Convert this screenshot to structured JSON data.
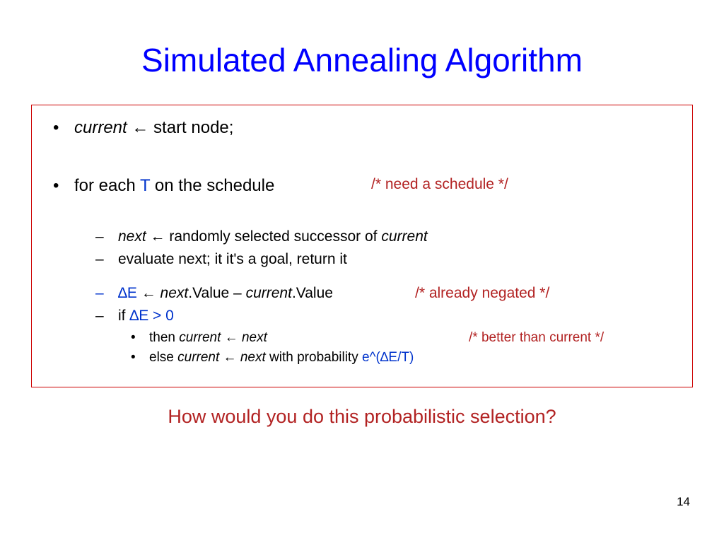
{
  "title": "Simulated Annealing Algorithm",
  "lines": {
    "l1a_pre": "current",
    "l1a_arrow": " ← ",
    "l1a_post": "start node;",
    "l1b_pre": "for each ",
    "l1b_T": "T",
    "l1b_post": " on the schedule",
    "l1b_comment": "/* need a schedule */",
    "l2a_pre": "next",
    "l2a_arrow": " ← ",
    "l2a_mid": "randomly selected successor of ",
    "l2a_post": "current",
    "l2b": "evaluate next; it it's a goal, return it",
    "l2c_dE": "∆E",
    "l2c_arrow": "  ←  ",
    "l2c_nv": "next",
    "l2c_dot1": ".Value – ",
    "l2c_cv": "current",
    "l2c_dot2": ".Value",
    "l2c_comment": "/* already negated */",
    "l2d_pre": "if ",
    "l2d_cond": "∆E > 0",
    "l3a_pre": "then ",
    "l3a_cur": "current",
    "l3a_arrow": " ← ",
    "l3a_nxt": "next",
    "l3a_comment": "/* better than current */",
    "l3b_pre": "else ",
    "l3b_cur": "current",
    "l3b_arrow": " ← ",
    "l3b_nxt": "next",
    "l3b_mid": " with probability ",
    "l3b_prob": "e^(∆E/T)"
  },
  "footer_question": "How would you do this probabilistic selection?",
  "page_number": "14"
}
